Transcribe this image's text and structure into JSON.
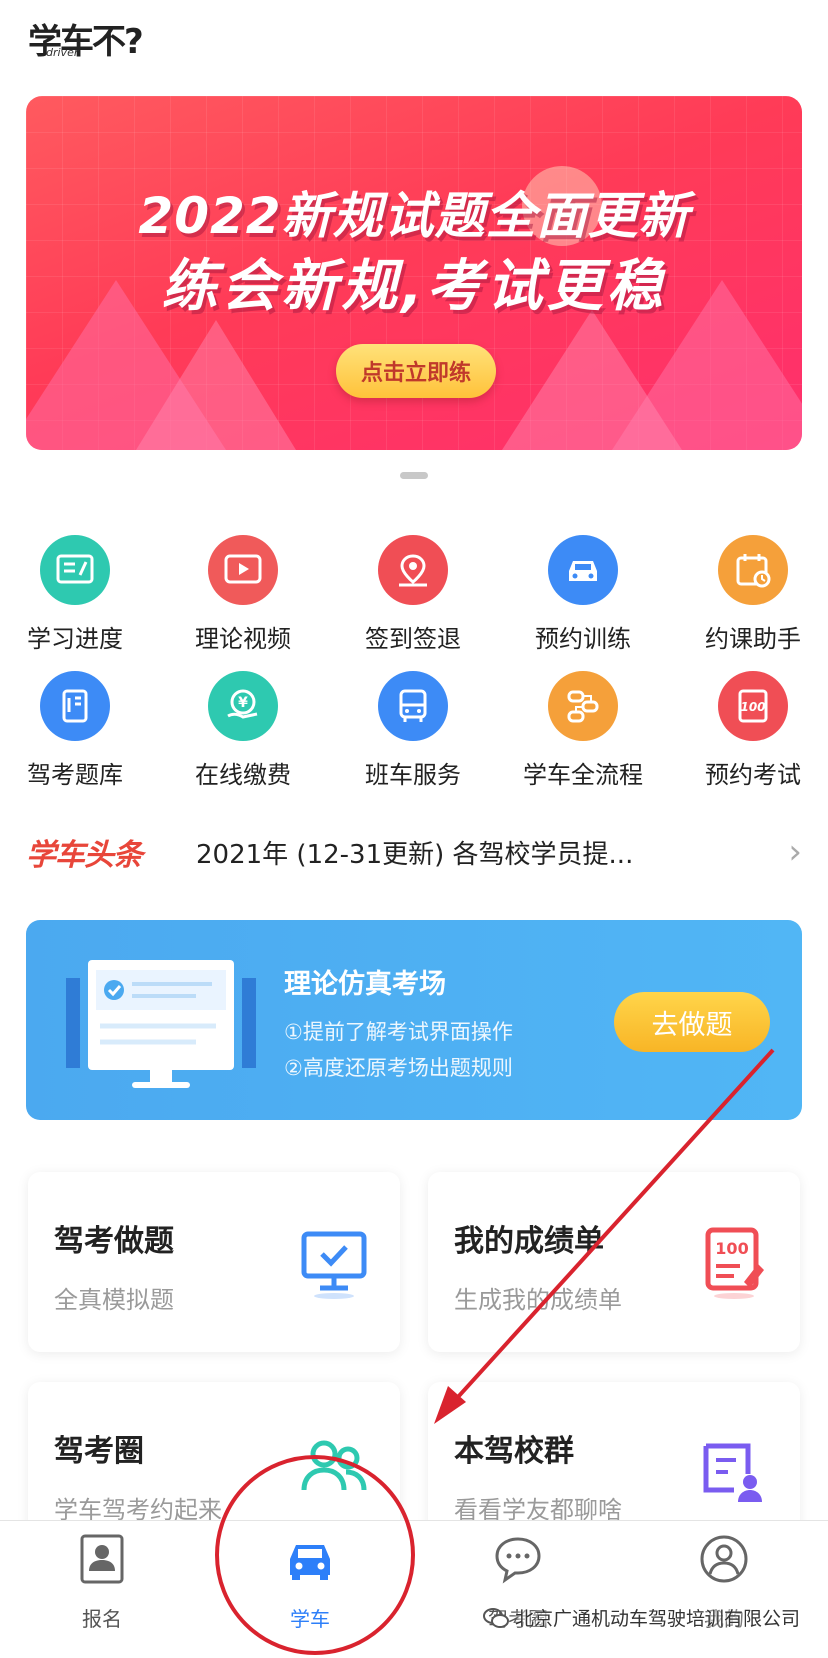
{
  "app": {
    "logo_text": "学车不?",
    "logo_sub": "driver"
  },
  "banner": {
    "line1": "2022新规试题全面更新",
    "line2": "练会新规,考试更稳",
    "button": "点击立即练"
  },
  "grid": {
    "items": [
      {
        "label": "学习进度",
        "icon": "study-progress-icon",
        "color": "#2ec9b0"
      },
      {
        "label": "理论视频",
        "icon": "video-icon",
        "color": "#f05a5a"
      },
      {
        "label": "签到签退",
        "icon": "location-pin-icon",
        "color": "#f04e55"
      },
      {
        "label": "预约训练",
        "icon": "car-icon",
        "color": "#3d8bf6"
      },
      {
        "label": "约课助手",
        "icon": "calendar-clock-icon",
        "color": "#f5a03a"
      },
      {
        "label": "驾考题库",
        "icon": "question-bank-icon",
        "color": "#3d8bf6"
      },
      {
        "label": "在线缴费",
        "icon": "yuan-payment-icon",
        "color": "#2ec9b0"
      },
      {
        "label": "班车服务",
        "icon": "bus-icon",
        "color": "#3d8bf6"
      },
      {
        "label": "学车全流程",
        "icon": "process-flow-icon",
        "color": "#f5a03a"
      },
      {
        "label": "预约考试",
        "icon": "exam-100-icon",
        "color": "#f04e55"
      }
    ]
  },
  "headline": {
    "brand": "学车头条",
    "text": "2021年 (12-31更新) 各驾校学员提..."
  },
  "sim": {
    "title": "理论仿真考场",
    "line1": "①提前了解考试界面操作",
    "line2": "②高度还原考场出题规则",
    "button": "去做题"
  },
  "cards": [
    {
      "title": "驾考做题",
      "sub": "全真模拟题",
      "icon": "monitor-check-icon"
    },
    {
      "title": "我的成绩单",
      "sub": "生成我的成绩单",
      "icon": "score-report-icon"
    },
    {
      "title": "驾考圈",
      "sub": "学车驾考约起来",
      "icon": "people-group-icon"
    },
    {
      "title": "本驾校群",
      "sub": "看看学友都聊啥",
      "icon": "school-group-icon"
    }
  ],
  "tabbar": {
    "tabs": [
      {
        "label": "报名",
        "icon": "id-card-icon"
      },
      {
        "label": "学车",
        "icon": "car-icon"
      },
      {
        "label": "驾考圈",
        "icon": "chat-bubble-icon"
      },
      {
        "label": "我的",
        "icon": "user-profile-icon"
      }
    ],
    "active_index": 1
  },
  "watermark": "北京广通机动车驾驶培训有限公司",
  "colors": {
    "accent_blue": "#2d7ff9",
    "banner_red": "#ff3b57",
    "annotation_red": "#d9232e"
  }
}
